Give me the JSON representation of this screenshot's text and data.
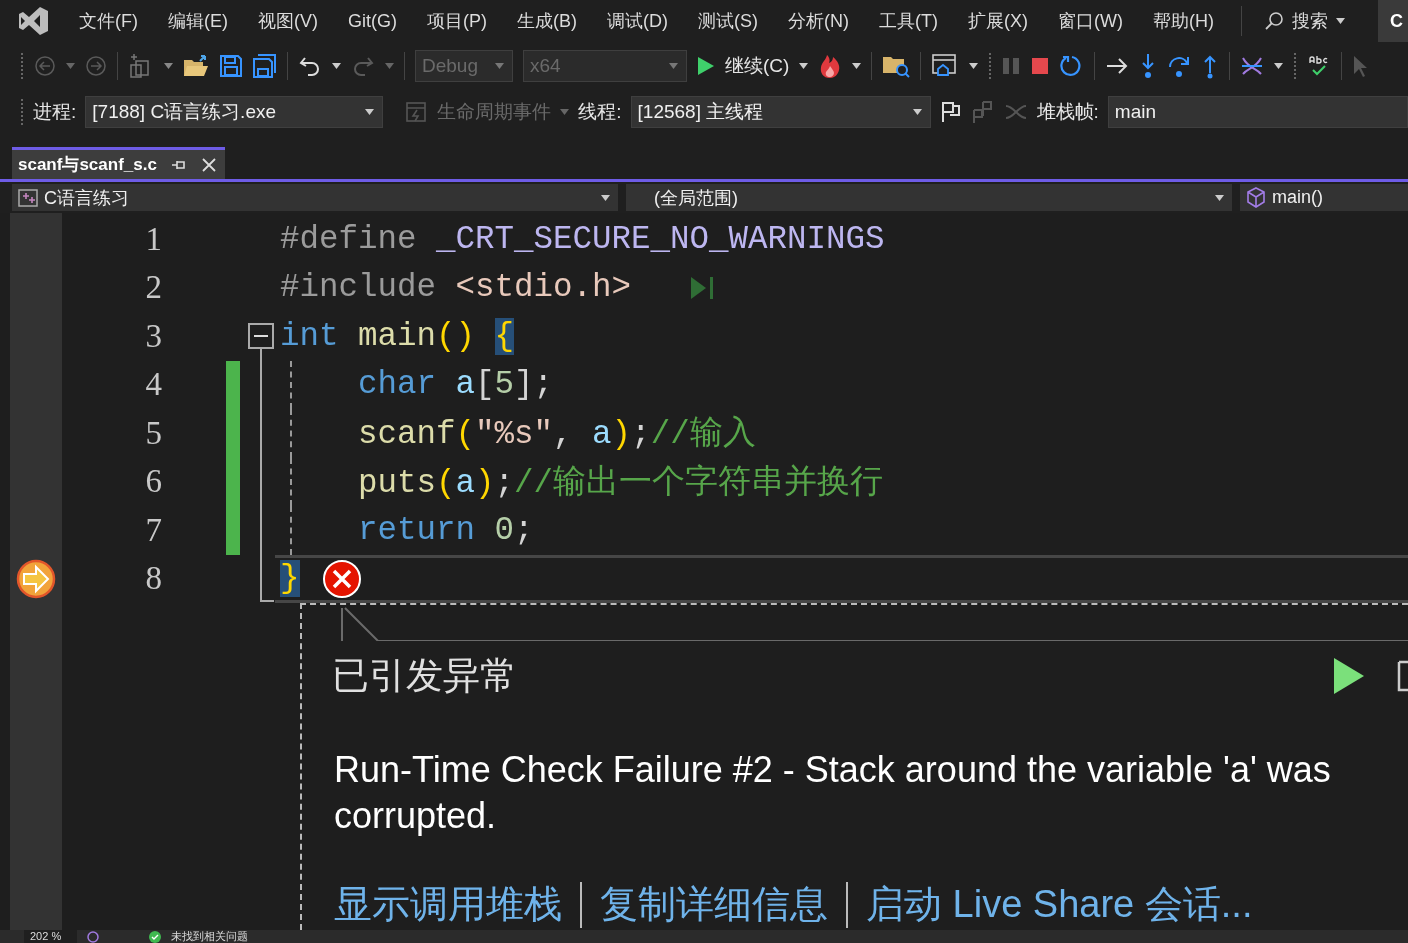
{
  "menu_bar": {
    "items": [
      {
        "label": "文件(F)"
      },
      {
        "label": "编辑(E)"
      },
      {
        "label": "视图(V)"
      },
      {
        "label": "Git(G)"
      },
      {
        "label": "项目(P)"
      },
      {
        "label": "生成(B)"
      },
      {
        "label": "调试(D)"
      },
      {
        "label": "测试(S)"
      },
      {
        "label": "分析(N)"
      },
      {
        "label": "工具(T)"
      },
      {
        "label": "扩展(X)"
      },
      {
        "label": "窗口(W)"
      },
      {
        "label": "帮助(H)"
      }
    ],
    "search": {
      "label": "搜索"
    },
    "solution_button": {
      "label": "C"
    }
  },
  "debug_toolbar": {
    "configuration": {
      "label": "Debug",
      "disabled": true
    },
    "platform": {
      "label": "x64",
      "disabled": true
    },
    "continue_button": {
      "label": "继续(C)"
    }
  },
  "location_toolbar": {
    "process_label": "进程:",
    "process": "[7188] C语言练习.exe",
    "lifecycle_events": {
      "label": "生命周期事件",
      "disabled": true
    },
    "thread_label": "线程:",
    "thread": "[12568] 主线程",
    "stack_frame_label": "堆栈帧:",
    "stack_frame": "main"
  },
  "tabs": [
    {
      "label": "scanf与scanf_s.c",
      "selected": true
    }
  ],
  "navigation_bar": {
    "project": "C语言练习",
    "scope": "(全局范围)",
    "member": "main()"
  },
  "editor": {
    "lines": [
      {
        "number": "1",
        "tokens": [
          {
            "text": "#define ",
            "kind": "preprocessor"
          },
          {
            "text": "_CRT_SECURE_NO_WARNINGS",
            "kind": "macro"
          }
        ]
      },
      {
        "number": "2",
        "run_to_click": true,
        "tokens": [
          {
            "text": "#include ",
            "kind": "preprocessor"
          },
          {
            "text": "<stdio.h>",
            "kind": "include"
          }
        ]
      },
      {
        "number": "3",
        "fold_start": true,
        "tokens": [
          {
            "text": "int ",
            "kind": "keyword"
          },
          {
            "text": "main",
            "kind": "function"
          },
          {
            "text": "() ",
            "kind": "paren"
          },
          {
            "text": "{",
            "kind": "brace-match"
          }
        ]
      },
      {
        "number": "4",
        "in_fold": true,
        "modified": true,
        "indented": true,
        "tokens": [
          {
            "text": "char ",
            "kind": "keyword"
          },
          {
            "text": "a",
            "kind": "variable"
          },
          {
            "text": "[",
            "kind": "punct"
          },
          {
            "text": "5",
            "kind": "number"
          },
          {
            "text": "];",
            "kind": "punct"
          }
        ]
      },
      {
        "number": "5",
        "in_fold": true,
        "modified": true,
        "indented": true,
        "tokens": [
          {
            "text": "scanf",
            "kind": "function"
          },
          {
            "text": "(",
            "kind": "paren"
          },
          {
            "text": "\"%s\"",
            "kind": "string"
          },
          {
            "text": ", ",
            "kind": "punct"
          },
          {
            "text": "a",
            "kind": "variable"
          },
          {
            "text": ")",
            "kind": "paren"
          },
          {
            "text": ";",
            "kind": "punct"
          },
          {
            "text": "//输入",
            "kind": "comment"
          }
        ]
      },
      {
        "number": "6",
        "in_fold": true,
        "modified": true,
        "indented": true,
        "tokens": [
          {
            "text": "puts",
            "kind": "function"
          },
          {
            "text": "(",
            "kind": "paren"
          },
          {
            "text": "a",
            "kind": "variable"
          },
          {
            "text": ")",
            "kind": "paren"
          },
          {
            "text": ";",
            "kind": "punct"
          },
          {
            "text": "//输出一个字符串并换行",
            "kind": "comment"
          }
        ]
      },
      {
        "number": "7",
        "in_fold": true,
        "modified": true,
        "indented": true,
        "tokens": [
          {
            "text": "return ",
            "kind": "keyword"
          },
          {
            "text": "0",
            "kind": "number"
          },
          {
            "text": ";",
            "kind": "punct"
          }
        ]
      },
      {
        "number": "8",
        "fold_end": true,
        "current": true,
        "error": true,
        "tokens": [
          {
            "text": "}",
            "kind": "brace-match"
          }
        ]
      }
    ]
  },
  "exception_popup": {
    "title": "已引发异常",
    "message": "Run-Time Check Failure #2 - Stack around the variable 'a' was corrupted.",
    "links": [
      "显示调用堆栈",
      "复制详细信息",
      "启动 Live Share 会话..."
    ]
  },
  "status_bar": {
    "zoom": "202 %",
    "issues": "未找到相关问题"
  }
}
